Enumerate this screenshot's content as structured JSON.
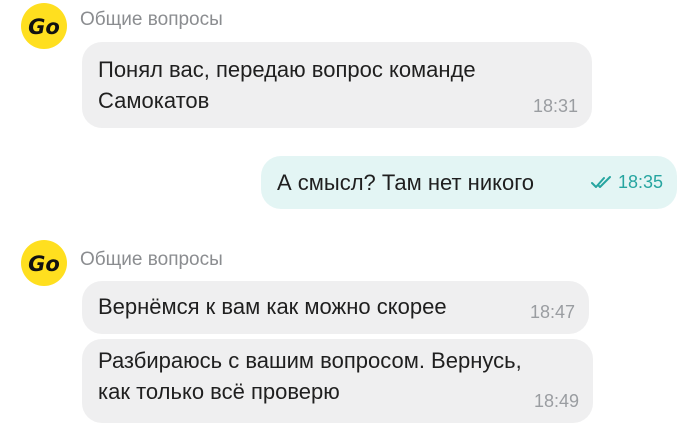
{
  "colors": {
    "incoming_bubble": "#efeff0",
    "outgoing_bubble": "#e3f5f4",
    "outgoing_time": "#26a5a0",
    "avatar_bg": "#ffdf1f",
    "sender_text": "#8b8d90"
  },
  "messages": [
    {
      "direction": "incoming",
      "avatar": {
        "logo_text": "Go",
        "icon": "go-logo-icon"
      },
      "sender": "Общие вопросы",
      "text": "Понял вас, передаю вопрос команде\nСамокатов",
      "time": "18:31"
    },
    {
      "direction": "outgoing",
      "text": "А смысл? Там нет никого",
      "time": "18:35",
      "status_icon": "double-check-icon"
    },
    {
      "direction": "incoming",
      "avatar": {
        "logo_text": "Go",
        "icon": "go-logo-icon"
      },
      "sender": "Общие вопросы",
      "text": "Вернёмся к вам как можно скорее",
      "time": "18:47"
    },
    {
      "direction": "incoming",
      "text": "Разбираюсь с вашим вопросом. Вернусь,\nкак только всё проверю",
      "time": "18:49"
    }
  ]
}
